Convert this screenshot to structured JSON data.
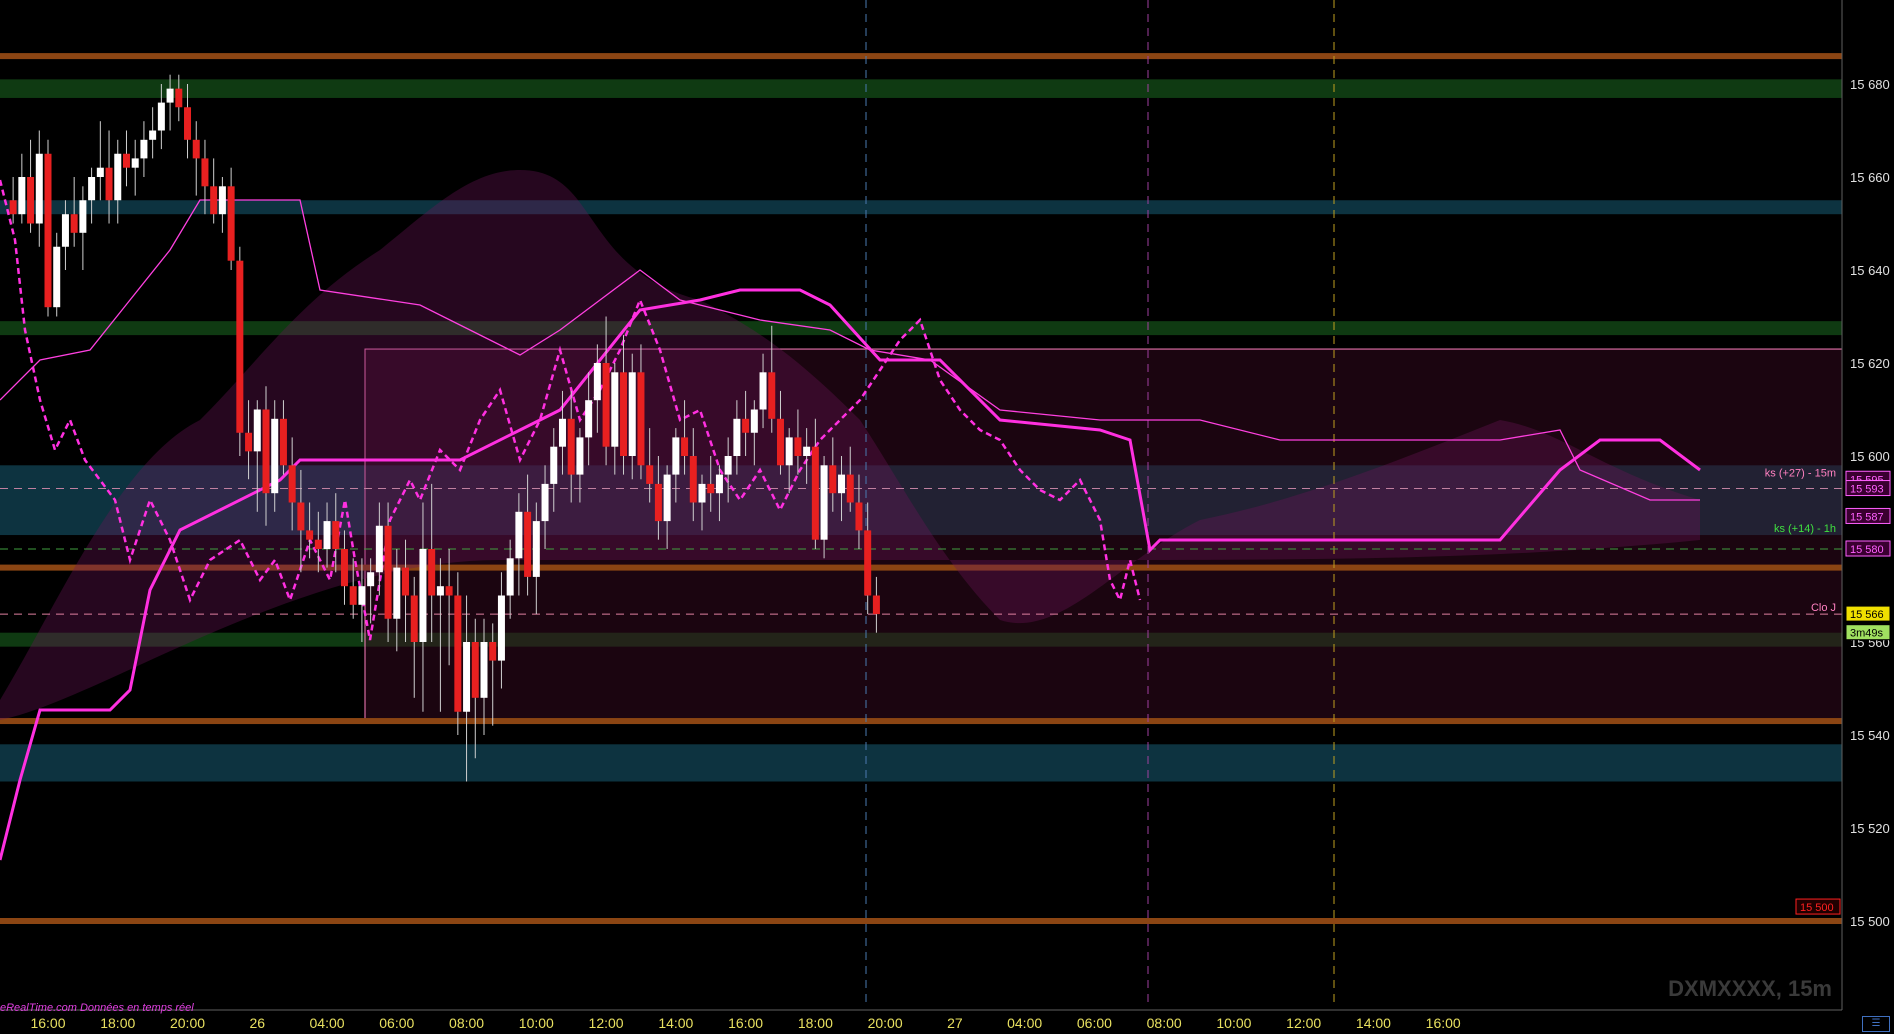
{
  "chart_data": {
    "type": "candlestick",
    "instrument": "DXMXXXX, 15m",
    "source_note": "eRealTime.com  Données en temps réel",
    "y_range": [
      15500,
      15690
    ],
    "y_ticks": [
      "15 680",
      "15 660",
      "15 640",
      "15 620",
      "15 600",
      "15 580",
      "15 560",
      "15 540",
      "15 520",
      "15 500"
    ],
    "y_tick_values": [
      15680,
      15660,
      15640,
      15620,
      15600,
      15580,
      15560,
      15540,
      15520,
      15500
    ],
    "x_ticks": [
      "16:00",
      "18:00",
      "20:00",
      "26",
      "04:00",
      "06:00",
      "08:00",
      "10:00",
      "12:00",
      "14:00",
      "16:00",
      "18:00",
      "20:00",
      "27",
      "04:00",
      "06:00",
      "08:00",
      "10:00",
      "12:00",
      "14:00",
      "16:00"
    ],
    "x_tick_index": [
      4,
      12,
      20,
      28,
      36,
      44,
      52,
      60,
      68,
      76,
      84,
      92,
      100,
      108,
      116,
      124,
      132,
      140,
      148,
      156,
      164
    ],
    "horizontal_levels": [
      {
        "price": 15686,
        "color": "#8b4513"
      },
      {
        "price": 15500,
        "color": "#8b4513"
      },
      {
        "price": 15576,
        "color": "#8b4513"
      },
      {
        "price": 15543,
        "color": "#8b4513"
      }
    ],
    "zones": [
      {
        "from": 15677,
        "to": 15681,
        "color": "#0f3a12"
      },
      {
        "from": 15652,
        "to": 15655,
        "color": "#0d3340"
      },
      {
        "from": 15626,
        "to": 15629,
        "color": "#0f3a12"
      },
      {
        "from": 15583,
        "to": 15598,
        "color": "#0d3340"
      },
      {
        "from": 15559,
        "to": 15562,
        "color": "#0f3a12"
      },
      {
        "from": 15530,
        "to": 15538,
        "color": "#0d3340"
      }
    ],
    "price_tags": [
      {
        "label": "15 595",
        "value": 15595,
        "bg": "#3a0030",
        "fg": "#ff60ff"
      },
      {
        "label": "15 593",
        "value": 15593,
        "bg": "#3a0030",
        "fg": "#ff60ff"
      },
      {
        "label": "15 587",
        "value": 15587,
        "bg": "#3a0030",
        "fg": "#ff60ff"
      },
      {
        "label": "15 580",
        "value": 15580,
        "bg": "#3a0030",
        "fg": "#ff60ff"
      },
      {
        "label": "15 566",
        "value": 15566,
        "bg": "#f0e000",
        "fg": "#000000"
      },
      {
        "label": "3m49s",
        "value": 15562,
        "bg": "#a0e060",
        "fg": "#000000"
      },
      {
        "label": "15 500",
        "value": 15503,
        "bg": "#200000",
        "fg": "#ff2020"
      }
    ],
    "annotations": [
      {
        "text": "ks (+27) - 15m",
        "value": 15595,
        "color": "#ff80c0"
      },
      {
        "text": "ks (+14) - 1h",
        "value": 15583,
        "color": "#40e040"
      },
      {
        "text": "Clo J",
        "value": 15566,
        "color": "#ff80c0"
      }
    ],
    "candles": [
      [
        15655,
        15660,
        15650,
        15652
      ],
      [
        15652,
        15665,
        15650,
        15660
      ],
      [
        15660,
        15668,
        15648,
        15650
      ],
      [
        15650,
        15670,
        15645,
        15665
      ],
      [
        15665,
        15668,
        15630,
        15632
      ],
      [
        15632,
        15648,
        15630,
        15645
      ],
      [
        15645,
        15655,
        15640,
        15652
      ],
      [
        15652,
        15660,
        15645,
        15648
      ],
      [
        15648,
        15658,
        15640,
        15655
      ],
      [
        15655,
        15662,
        15650,
        15660
      ],
      [
        15660,
        15672,
        15655,
        15662
      ],
      [
        15662,
        15670,
        15650,
        15655
      ],
      [
        15655,
        15668,
        15650,
        15665
      ],
      [
        15665,
        15670,
        15658,
        15662
      ],
      [
        15662,
        15668,
        15656,
        15664
      ],
      [
        15664,
        15672,
        15660,
        15668
      ],
      [
        15668,
        15675,
        15664,
        15670
      ],
      [
        15670,
        15680,
        15666,
        15676
      ],
      [
        15676,
        15682,
        15670,
        15679
      ],
      [
        15679,
        15682,
        15672,
        15675
      ],
      [
        15675,
        15680,
        15664,
        15668
      ],
      [
        15668,
        15672,
        15656,
        15664
      ],
      [
        15664,
        15668,
        15652,
        15658
      ],
      [
        15658,
        15664,
        15650,
        15652
      ],
      [
        15652,
        15660,
        15648,
        15658
      ],
      [
        15658,
        15662,
        15640,
        15642
      ],
      [
        15642,
        15645,
        15600,
        15605
      ],
      [
        15605,
        15612,
        15595,
        15601
      ],
      [
        15601,
        15612,
        15588,
        15610
      ],
      [
        15610,
        15615,
        15585,
        15592
      ],
      [
        15592,
        15612,
        15588,
        15608
      ],
      [
        15608,
        15612,
        15596,
        15598
      ],
      [
        15598,
        15604,
        15584,
        15590
      ],
      [
        15590,
        15597,
        15575,
        15584
      ],
      [
        15584,
        15590,
        15578,
        15582
      ],
      [
        15582,
        15588,
        15575,
        15580
      ],
      [
        15580,
        15590,
        15576,
        15586
      ],
      [
        15586,
        15592,
        15575,
        15580
      ],
      [
        15580,
        15584,
        15568,
        15572
      ],
      [
        15572,
        15578,
        15565,
        15568
      ],
      [
        15568,
        15578,
        15560,
        15572
      ],
      [
        15572,
        15578,
        15564,
        15575
      ],
      [
        15575,
        15590,
        15570,
        15585
      ],
      [
        15585,
        15590,
        15560,
        15565
      ],
      [
        15565,
        15580,
        15558,
        15576
      ],
      [
        15576,
        15582,
        15560,
        15570
      ],
      [
        15570,
        15574,
        15548,
        15560
      ],
      [
        15560,
        15590,
        15545,
        15580
      ],
      [
        15580,
        15594,
        15560,
        15570
      ],
      [
        15570,
        15578,
        15545,
        15572
      ],
      [
        15572,
        15580,
        15555,
        15570
      ],
      [
        15570,
        15575,
        15540,
        15545
      ],
      [
        15545,
        15570,
        15530,
        15560
      ],
      [
        15560,
        15565,
        15535,
        15548
      ],
      [
        15548,
        15565,
        15540,
        15560
      ],
      [
        15560,
        15564,
        15542,
        15556
      ],
      [
        15556,
        15575,
        15550,
        15570
      ],
      [
        15570,
        15582,
        15565,
        15578
      ],
      [
        15578,
        15592,
        15570,
        15588
      ],
      [
        15588,
        15596,
        15570,
        15574
      ],
      [
        15574,
        15590,
        15566,
        15586
      ],
      [
        15586,
        15598,
        15580,
        15594
      ],
      [
        15594,
        15606,
        15588,
        15602
      ],
      [
        15602,
        15614,
        15596,
        15608
      ],
      [
        15608,
        15614,
        15590,
        15596
      ],
      [
        15596,
        15606,
        15590,
        15604
      ],
      [
        15604,
        15618,
        15598,
        15612
      ],
      [
        15612,
        15624,
        15605,
        15620
      ],
      [
        15620,
        15630,
        15598,
        15602
      ],
      [
        15602,
        15620,
        15596,
        15618
      ],
      [
        15618,
        15626,
        15596,
        15600
      ],
      [
        15600,
        15622,
        15595,
        15618
      ]
    ],
    "candles2": [
      [
        15618,
        15624,
        15595,
        15598
      ],
      [
        15598,
        15606,
        15590,
        15594
      ],
      [
        15594,
        15600,
        15582,
        15586
      ],
      [
        15586,
        15598,
        15580,
        15596
      ],
      [
        15596,
        15606,
        15590,
        15604
      ],
      [
        15604,
        15612,
        15596,
        15600
      ],
      [
        15600,
        15606,
        15586,
        15590
      ],
      [
        15590,
        15596,
        15584,
        15594
      ],
      [
        15594,
        15600,
        15588,
        15592
      ],
      [
        15592,
        15598,
        15586,
        15596
      ],
      [
        15596,
        15604,
        15590,
        15600
      ],
      [
        15600,
        15612,
        15596,
        15608
      ],
      [
        15608,
        15614,
        15600,
        15605
      ],
      [
        15605,
        15612,
        15598,
        15610
      ],
      [
        15610,
        15622,
        15606,
        15618
      ],
      [
        15618,
        15628,
        15605,
        15608
      ],
      [
        15608,
        15614,
        15596,
        15598
      ],
      [
        15598,
        15606,
        15592,
        15604
      ],
      [
        15604,
        15610,
        15596,
        15600
      ],
      [
        15600,
        15606,
        15594,
        15602
      ],
      [
        15602,
        15608,
        15580,
        15582
      ],
      [
        15582,
        15600,
        15578,
        15598
      ],
      [
        15598,
        15604,
        15588,
        15592
      ],
      [
        15592,
        15600,
        15586,
        15596
      ],
      [
        15596,
        15602,
        15588,
        15590
      ],
      [
        15590,
        15596,
        15580,
        15584
      ],
      [
        15584,
        15590,
        15566,
        15570
      ],
      [
        15570,
        15574,
        15562,
        15566
      ]
    ]
  }
}
